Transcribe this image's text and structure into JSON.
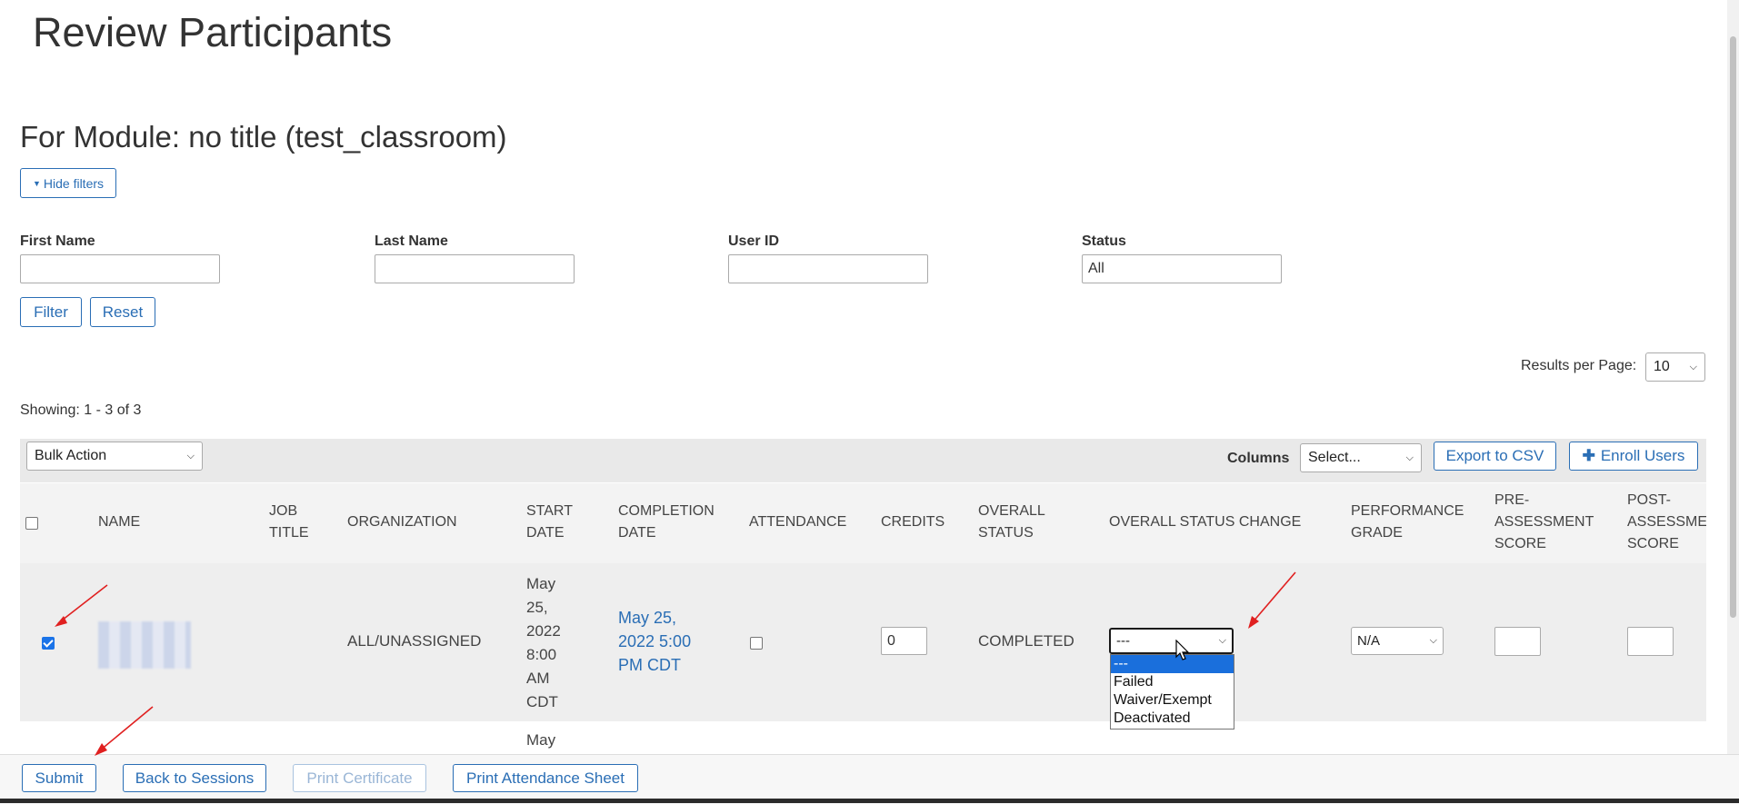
{
  "page_title": "Review Participants",
  "module_heading": "For Module: no title (test_classroom)",
  "hide_filters_label": "Hide filters",
  "filters": {
    "first_name_label": "First Name",
    "last_name_label": "Last Name",
    "user_id_label": "User ID",
    "status_label": "Status",
    "status_value": "All",
    "filter_button": "Filter",
    "reset_button": "Reset"
  },
  "results_per_page_label": "Results per Page:",
  "results_per_page_value": "10",
  "showing_text": "Showing: 1 - 3 of 3",
  "toolbar": {
    "bulk_action": "Bulk Action",
    "columns_label": "Columns",
    "columns_select": "Select...",
    "export_csv": "Export to CSV",
    "enroll_users": "Enroll Users"
  },
  "columns": {
    "name": "NAME",
    "job_title": [
      "JOB",
      "TITLE"
    ],
    "organization": "ORGANIZATION",
    "start_date": [
      "START",
      "DATE"
    ],
    "completion_date": [
      "COMPLETION",
      "DATE"
    ],
    "attendance": "ATTENDANCE",
    "credits": "CREDITS",
    "overall_status": [
      "OVERALL",
      "STATUS"
    ],
    "overall_status_change": "OVERALL STATUS CHANGE",
    "performance_grade": [
      "PERFORMANCE",
      "GRADE"
    ],
    "pre_assessment": [
      "PRE-",
      "ASSESSMENT",
      "SCORE"
    ],
    "post_assessment": [
      "POST-",
      "ASSESSMENT",
      "SCORE"
    ]
  },
  "rows": [
    {
      "organization": "ALL/UNASSIGNED",
      "start_date": [
        "May",
        "25,",
        "2022",
        "8:00",
        "AM",
        "CDT"
      ],
      "completion_date": [
        "May 25,",
        "2022 5:00",
        "PM CDT"
      ],
      "credits": "0",
      "overall_status": "COMPLETED",
      "status_change": "---",
      "performance_grade": "N/A"
    },
    {
      "start_date_partial": "May"
    }
  ],
  "status_dropdown_options": [
    "---",
    "Failed",
    "Waiver/Exempt",
    "Deactivated"
  ],
  "footer": {
    "submit": "Submit",
    "back_to_sessions": "Back to Sessions",
    "print_certificate": "Print Certificate",
    "print_attendance": "Print Attendance Sheet"
  },
  "colors": {
    "accent": "#2a6eb5",
    "annotation_arrow": "#e02020"
  }
}
